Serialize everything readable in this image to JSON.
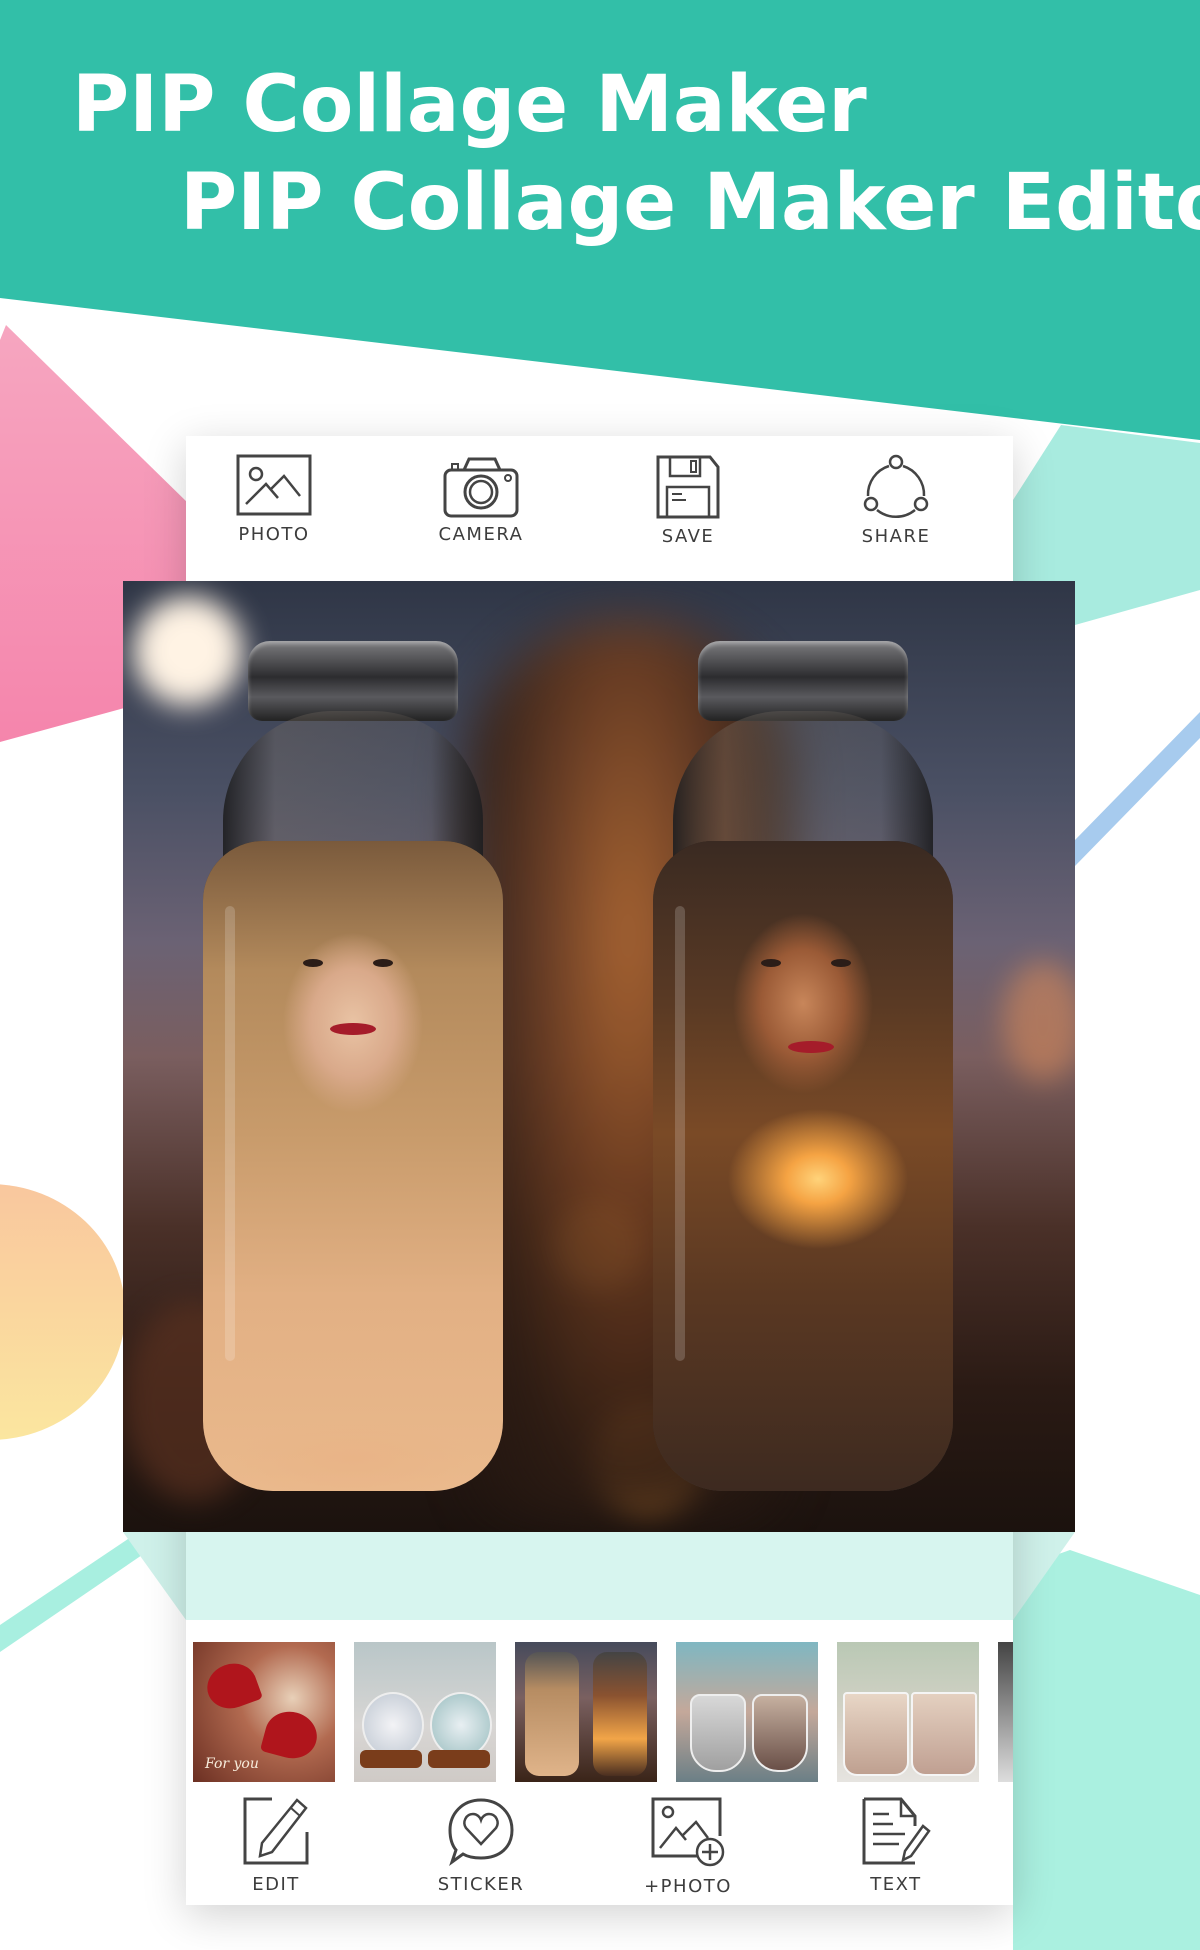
{
  "banner": {
    "line1": "PIP Collage Maker",
    "line2": "PIP Collage Maker Editor",
    "colors": {
      "teal": "#32BFA8",
      "pink": "#F48FB1",
      "mint": "#A8EBDF",
      "blue_stripe": "#A7CBEE",
      "peach_top": "#F9C9A0",
      "peach_bottom": "#FBE39E"
    }
  },
  "top_toolbar": [
    {
      "label": "PHOTO",
      "icon": "image-icon"
    },
    {
      "label": "CAMERA",
      "icon": "camera-icon"
    },
    {
      "label": "SAVE",
      "icon": "floppy-disk-icon"
    },
    {
      "label": "SHARE",
      "icon": "share-icon"
    }
  ],
  "editor": {
    "frame": "Bottle PIP frame",
    "thumbnails": [
      {
        "name": "Hearts frame",
        "caption": "For you"
      },
      {
        "name": "Snow globe frame",
        "caption": ""
      },
      {
        "name": "Bottle frame",
        "caption": ""
      },
      {
        "name": "Hanging glass frame",
        "caption": ""
      },
      {
        "name": "Glass cup frame",
        "caption": ""
      },
      {
        "name": "More frame",
        "caption": ""
      }
    ]
  },
  "bottom_toolbar": [
    {
      "label": "EDIT",
      "icon": "pencil-edit-icon"
    },
    {
      "label": "STICKER",
      "icon": "heart-bubble-icon"
    },
    {
      "label": "+PHOTO",
      "icon": "add-image-icon"
    },
    {
      "label": "TEXT",
      "icon": "document-text-icon"
    }
  ]
}
